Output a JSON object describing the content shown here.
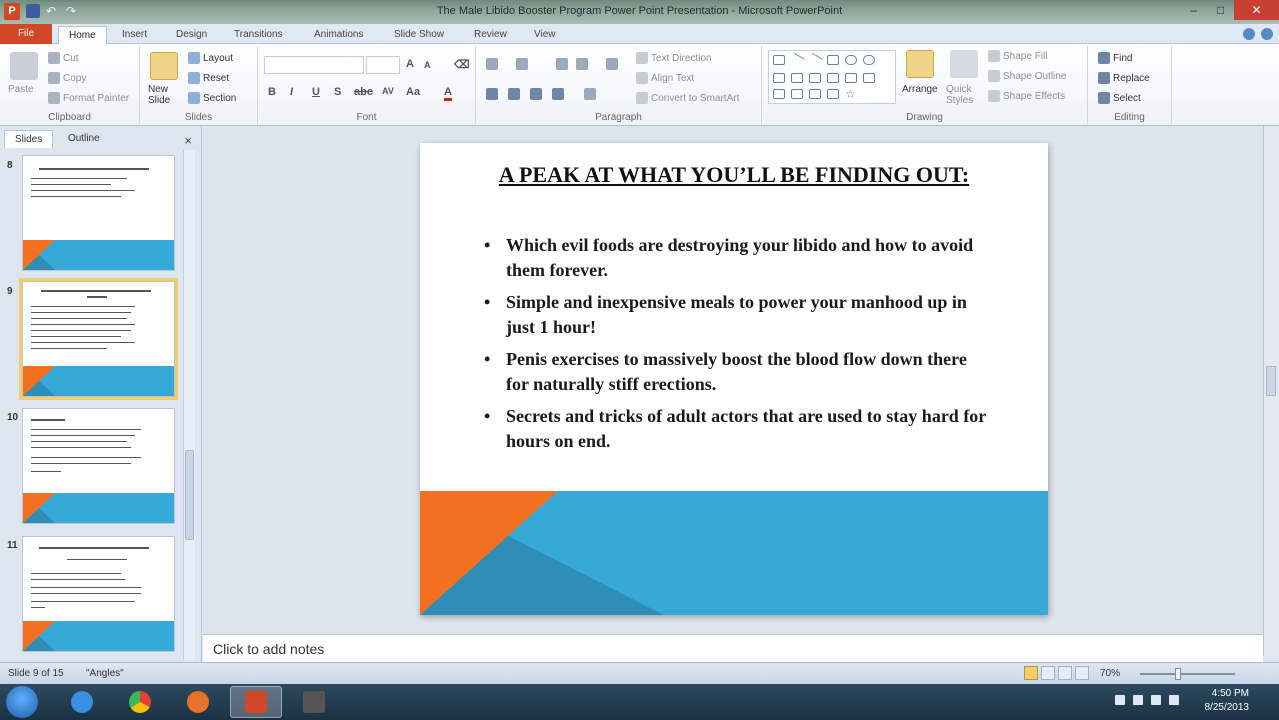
{
  "window": {
    "title": "The Male Libido Booster Program Power Point Presentation - Microsoft PowerPoint",
    "app_icon_letter": "P"
  },
  "ribbon_tabs": [
    "File",
    "Home",
    "Insert",
    "Design",
    "Transitions",
    "Animations",
    "Slide Show",
    "Review",
    "View"
  ],
  "ribbon": {
    "clipboard": {
      "paste": "Paste",
      "cut": "Cut",
      "copy": "Copy",
      "format_painter": "Format Painter",
      "label": "Clipboard"
    },
    "slides": {
      "new_slide": "New Slide",
      "layout": "Layout",
      "reset": "Reset",
      "section": "Section",
      "label": "Slides"
    },
    "font": {
      "label": "Font",
      "bold": "B",
      "italic": "I",
      "underline": "U",
      "strike": "S",
      "abc": "abc",
      "spacing": "AV",
      "case": "Aa",
      "color": "A",
      "grow": "A",
      "shrink": "A"
    },
    "paragraph": {
      "text_direction": "Text Direction",
      "align_text": "Align Text",
      "convert_smartart": "Convert to SmartArt",
      "label": "Paragraph"
    },
    "drawing": {
      "arrange": "Arrange",
      "quick_styles": "Quick Styles",
      "shape_fill": "Shape Fill",
      "shape_outline": "Shape Outline",
      "shape_effects": "Shape Effects",
      "label": "Drawing"
    },
    "editing": {
      "find": "Find",
      "replace": "Replace",
      "select": "Select",
      "label": "Editing"
    }
  },
  "left_panel": {
    "tabs": [
      "Slides",
      "Outline"
    ],
    "close": "×",
    "thumbnails": [
      {
        "number": "8"
      },
      {
        "number": "9"
      },
      {
        "number": "10"
      },
      {
        "number": "11"
      }
    ]
  },
  "slide": {
    "title": "A PEAK AT WHAT YOU’LL BE FINDING OUT:",
    "bullet_char": "•",
    "bullets": [
      "Which evil foods are destroying your libido and how to avoid them forever.",
      "Simple and inexpensive meals to power your manhood up in just 1 hour!",
      "Penis exercises to massively boost the blood flow down there for naturally  stiff erections.",
      "Secrets and tricks of adult actors that are used to stay hard for hours on end."
    ],
    "colors": {
      "band": "#35aad9",
      "band_dark": "#2f8eb6",
      "accent": "#f37021"
    }
  },
  "notes": {
    "placeholder": "Click to add notes"
  },
  "status_bar": {
    "slide_info": "Slide 9 of 15",
    "theme": "\"Angles\"",
    "zoom": "70%"
  },
  "taskbar": {
    "time": "4:50 PM",
    "date": "8/25/2013"
  }
}
